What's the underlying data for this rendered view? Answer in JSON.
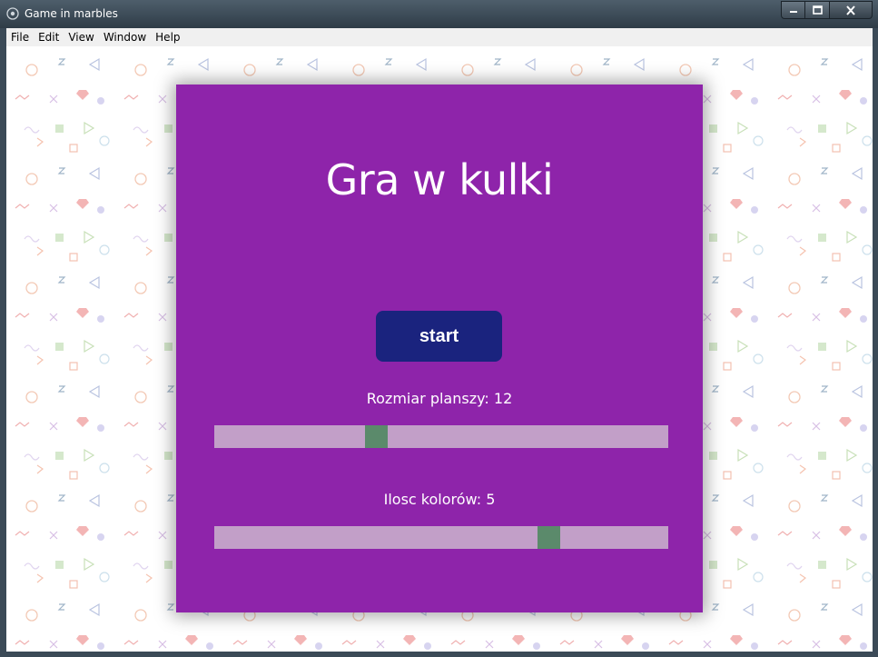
{
  "window": {
    "title": "Game in marbles"
  },
  "menu": {
    "items": [
      "File",
      "Edit",
      "View",
      "Window",
      "Help"
    ]
  },
  "game": {
    "title": "Gra w kulki",
    "start_label": "start",
    "board_size": {
      "label": "Rozmiar planszy: 12",
      "value": 12,
      "level": 0.35
    },
    "colors_count": {
      "label": "Ilosc kolorów: 5",
      "value": 5,
      "level": 0.75
    }
  },
  "colors": {
    "card": "#8e24aa",
    "button": "#1a237e",
    "track": "#c29fc8",
    "thumb": "#5b8a6b"
  }
}
